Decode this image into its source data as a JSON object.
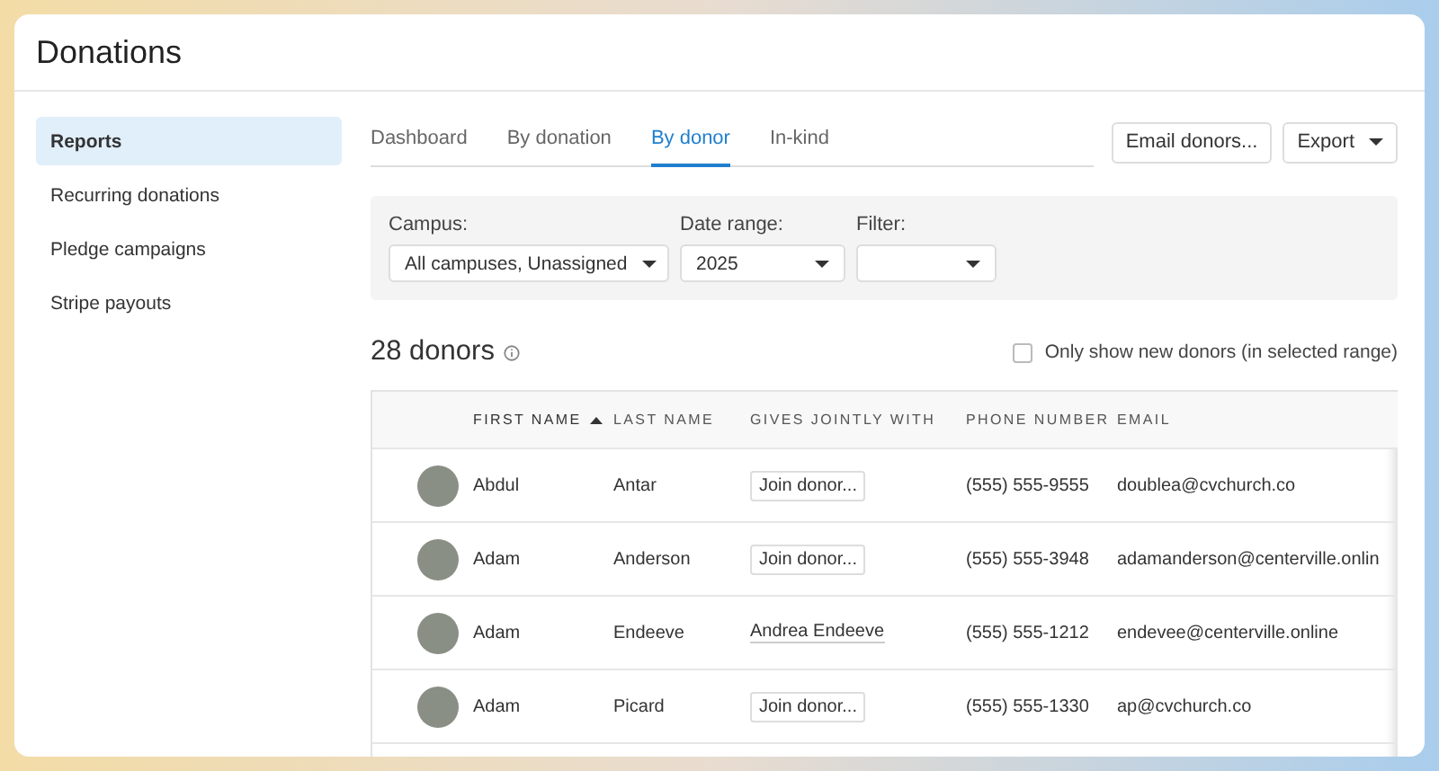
{
  "page": {
    "title": "Donations"
  },
  "sidebar": {
    "items": [
      {
        "label": "Reports",
        "selected": true
      },
      {
        "label": "Recurring donations",
        "selected": false
      },
      {
        "label": "Pledge campaigns",
        "selected": false
      },
      {
        "label": "Stripe payouts",
        "selected": false
      }
    ]
  },
  "tabs": [
    {
      "label": "Dashboard",
      "selected": false
    },
    {
      "label": "By donation",
      "selected": false
    },
    {
      "label": "By donor",
      "selected": true
    },
    {
      "label": "In-kind",
      "selected": false
    }
  ],
  "actions": [
    {
      "label": "Email donors...",
      "kind": "button"
    },
    {
      "label": "Export",
      "kind": "dropdown"
    }
  ],
  "filters": [
    {
      "label": "Campus:",
      "value": "All campuses, Unassigned"
    },
    {
      "label": "Date range:",
      "value": "2025"
    },
    {
      "label": "Filter:"
    }
  ],
  "summary": {
    "title": "28 donors",
    "new_only": {
      "label": "Only show new donors (in selected range)",
      "checked": false
    }
  },
  "table": {
    "columns": [
      {
        "label": "FIRST NAME",
        "sorted": true
      },
      {
        "label": "LAST NAME",
        "sorted": false
      },
      {
        "label": "GIVES JOINTLY WITH",
        "sorted": false
      },
      {
        "label": "PHONE NUMBER",
        "sorted": false
      },
      {
        "label": "EMAIL",
        "sorted": false
      }
    ],
    "rows": [
      {
        "first": "Abdul",
        "last": "Antar",
        "joint": {
          "kind": "button",
          "text": "Join donor..."
        },
        "phone": "(555) 555-9555",
        "email": "doublea@cvchurch.co"
      },
      {
        "first": "Adam",
        "last": "Anderson",
        "joint": {
          "kind": "button",
          "text": "Join donor..."
        },
        "phone": "(555) 555-3948",
        "email": "adamanderson@centerville.onlin"
      },
      {
        "first": "Adam",
        "last": "Endeeve",
        "joint": {
          "kind": "link",
          "text": "Andrea Endeeve"
        },
        "phone": "(555) 555-1212",
        "email": "endevee@centerville.online"
      },
      {
        "first": "Adam",
        "last": "Picard",
        "joint": {
          "kind": "button",
          "text": "Join donor..."
        },
        "phone": "(555) 555-1330",
        "email": "ap@cvchurch.co"
      }
    ]
  }
}
